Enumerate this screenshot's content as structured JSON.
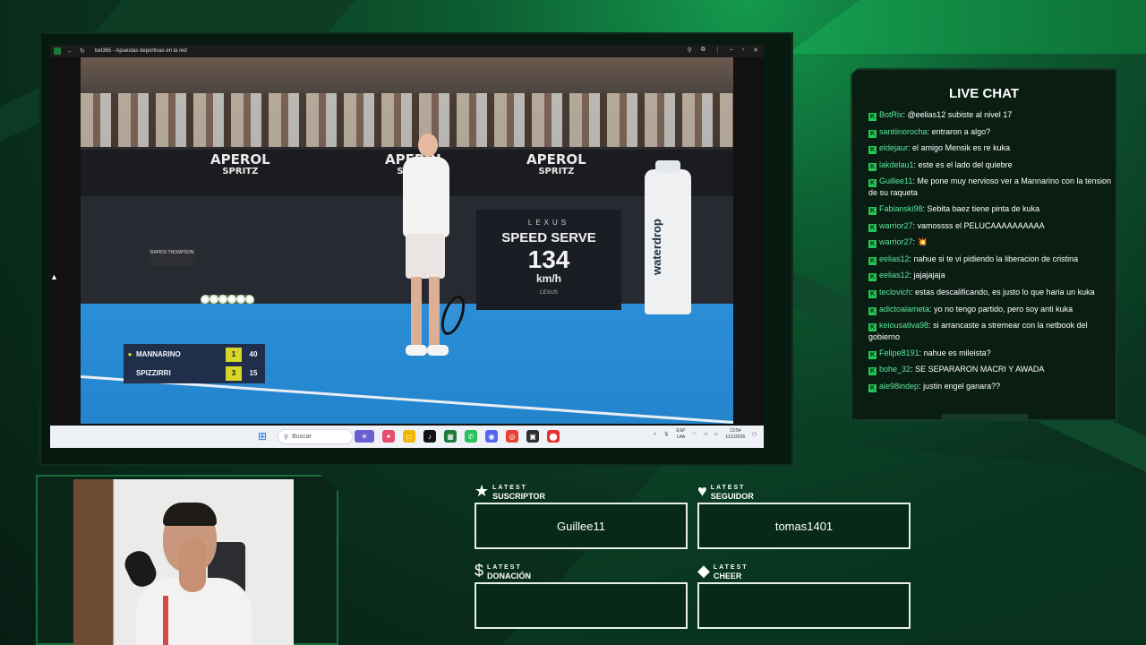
{
  "browser": {
    "tab_title": "bet365 - Apuestas deportivas en la red"
  },
  "stream": {
    "sponsor_aperol_1": "APEROL",
    "sponsor_aperol_2": "SPRITZ",
    "sponsor_box": "RAPIDS THOMPSON",
    "speed_board": {
      "brand": "LEXUS",
      "title": "SPEED SERVE",
      "value": "134",
      "unit": "km/h",
      "brand_small": "LEXUS"
    },
    "waterdrop": "waterdrop",
    "scoreboard": [
      {
        "name": "MANNARINO",
        "sets": "1",
        "points": "40",
        "serving": true
      },
      {
        "name": "SPIZZIRRI",
        "sets": "3",
        "points": "15",
        "serving": false
      }
    ]
  },
  "taskbar": {
    "search_placeholder": "Buscar",
    "lang": "ESP",
    "lang2": "LAA",
    "time": "13:54",
    "date": "11/1/2026"
  },
  "chat": {
    "title": "LIVE CHAT",
    "messages": [
      {
        "user": "BotRix",
        "text": "@eelias12 subiste al nivel 17"
      },
      {
        "user": "santiinorocha",
        "text": "entraron a algo?"
      },
      {
        "user": "eldejaur",
        "text": "el amigo Mensik es re kuka"
      },
      {
        "user": "lakdelau1",
        "text": "este es el lado del quiebre"
      },
      {
        "user": "Guillee11",
        "text": "Me pone muy nervioso ver a Mannarino con la tension de su raqueta"
      },
      {
        "user": "Fabianski98",
        "text": "Sebita baez tiene pinta de kuka"
      },
      {
        "user": "warrior27",
        "text": "vamossss el PELUCAAAAAAAAAA"
      },
      {
        "user": "warrior27",
        "text": "💥"
      },
      {
        "user": "eelias12",
        "text": "nahue si te vi pidiendo la liberacion de cristina"
      },
      {
        "user": "eelias12",
        "text": "jajajajaja"
      },
      {
        "user": "teclovich",
        "text": "estas descalificando, es justo lo que haria un kuka"
      },
      {
        "user": "adictoalameta",
        "text": "yo no tengo partido, pero soy anti kuka"
      },
      {
        "user": "keiousativa98",
        "text": "si arrancaste a stremear con la netbook del gobierno"
      },
      {
        "user": "Felipe8191",
        "text": "nahue es mileista?"
      },
      {
        "user": "bohe_32",
        "text": "SE SEPARARON MACRI Y AWADA"
      },
      {
        "user": "ale98indep",
        "text": "justin engel ganara??"
      }
    ]
  },
  "widgets": {
    "suscriptor": {
      "l1": "LATEST",
      "l2": "SUSCRIPTOR",
      "value": "Guillee11"
    },
    "seguidor": {
      "l1": "LATEST",
      "l2": "SEGUIDOR",
      "value": "tomas1401"
    },
    "donacion": {
      "l1": "LATEST",
      "l2": "DONACIÓN",
      "value": ""
    },
    "cheer": {
      "l1": "LATEST",
      "l2": "CHEER",
      "value": ""
    }
  },
  "colors": {
    "accent_green": "#24c554",
    "chat_user": "#5ee8a0",
    "score_yellow": "#e0dc1f"
  }
}
